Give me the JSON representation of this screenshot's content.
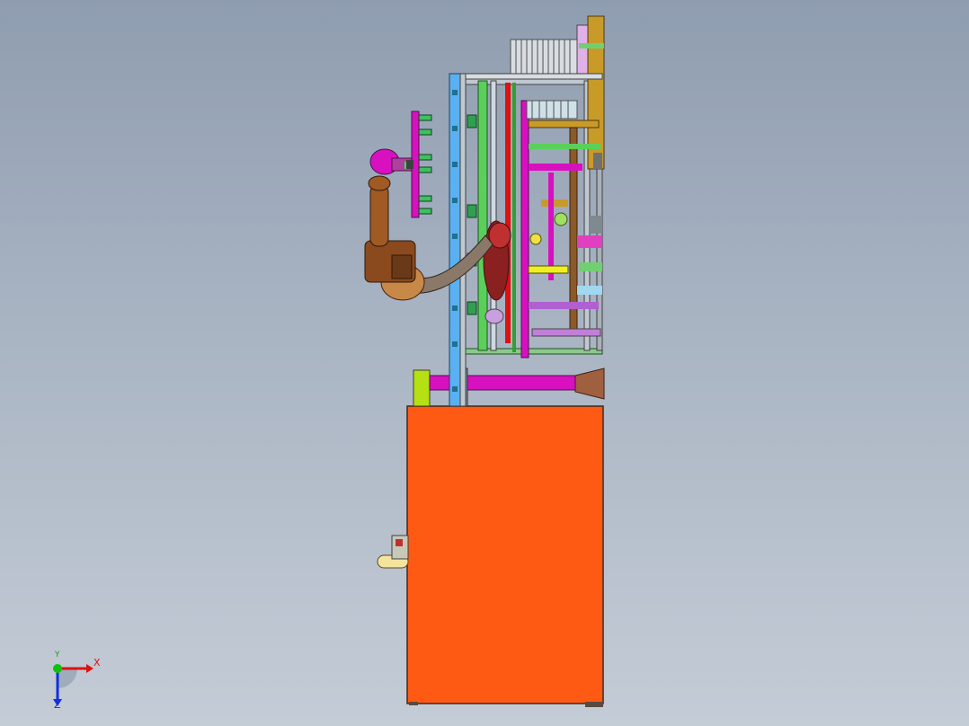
{
  "viewport": {
    "background_top": "#8f9db0",
    "background_bottom": "#c4ccd6"
  },
  "model": {
    "cabinet_color": "#ff5a14",
    "frame_color": "#6fb86f",
    "robot_color": "#8a4a1e",
    "gripper_color": "#d400c8",
    "panel_color": "#c89a28"
  },
  "triad": {
    "x_label": "X",
    "y_label": "Y",
    "z_label": "Z",
    "x_color": "#e01010",
    "y_color": "#10c010",
    "z_color": "#1030e0"
  }
}
